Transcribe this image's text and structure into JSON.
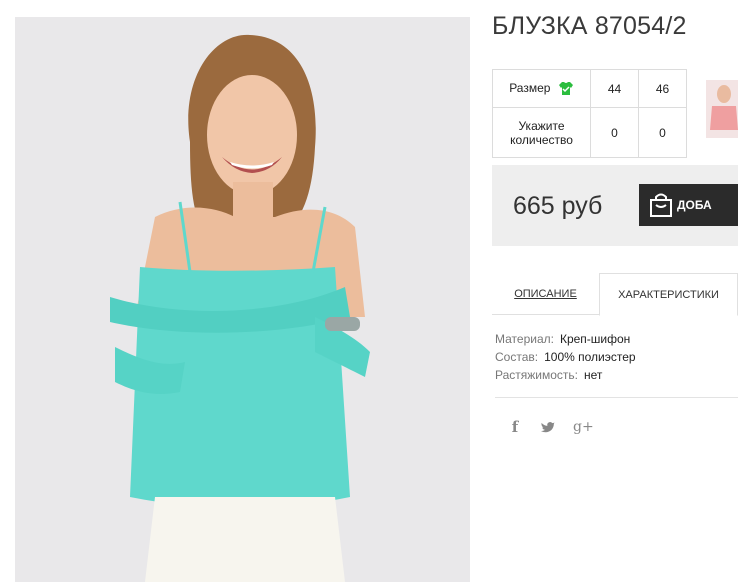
{
  "product": {
    "title": "БЛУЗКА 87054/2",
    "photo_icon": "model-photo",
    "thumbnail_icon": "product-thumbnail"
  },
  "size_table": {
    "size_label": "Размер",
    "qty_label": "Укажите количество",
    "sizes": [
      "44",
      "46"
    ],
    "quantities": [
      "0",
      "0"
    ],
    "size_chart_icon": "tshirt-icon"
  },
  "price": {
    "value": "665 руб",
    "buy_label": "ДОБА"
  },
  "tabs": {
    "description": "ОПИСАНИЕ",
    "characteristics": "ХАРАКТЕРИСТИКИ"
  },
  "specs": [
    {
      "key": "Материал:",
      "value": "Креп-шифон"
    },
    {
      "key": "Состав:",
      "value": "100% полиэстер"
    },
    {
      "key": "Растяжимость:",
      "value": "нет"
    }
  ],
  "social": {
    "facebook": "f",
    "twitter": "🐦",
    "google": "g+"
  },
  "colors": {
    "blouse": "#5fd8cc",
    "button_bg": "#2b2b2b",
    "price_bg": "#eeeeee",
    "icon_green": "#2bbd3e"
  }
}
